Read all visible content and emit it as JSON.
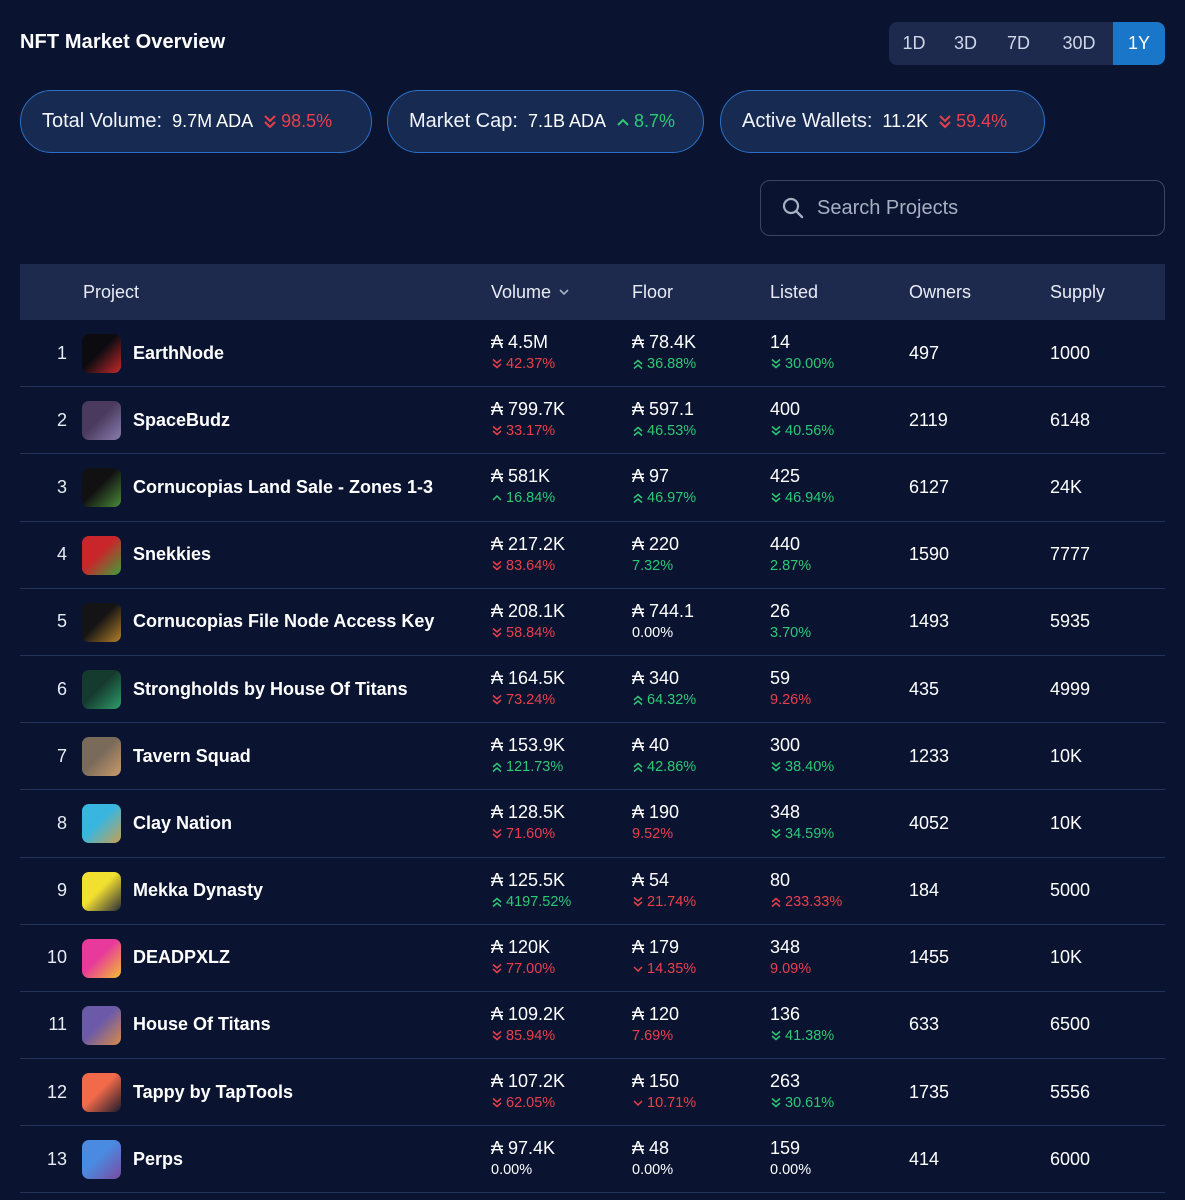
{
  "header": {
    "title": "NFT Market Overview"
  },
  "timeframes": [
    {
      "label": "1D",
      "active": false
    },
    {
      "label": "3D",
      "active": false
    },
    {
      "label": "7D",
      "active": false
    },
    {
      "label": "30D",
      "active": false
    },
    {
      "label": "1Y",
      "active": true
    }
  ],
  "stats": [
    {
      "label": "Total Volume:",
      "value": "9.7M ADA",
      "change": "98.5%",
      "direction": "down"
    },
    {
      "label": "Market Cap:",
      "value": "7.1B ADA",
      "change": "8.7%",
      "direction": "up"
    },
    {
      "label": "Active Wallets:",
      "value": "11.2K",
      "change": "59.4%",
      "direction": "down"
    }
  ],
  "search": {
    "placeholder": "Search Projects"
  },
  "table": {
    "columns": {
      "project": "Project",
      "volume": "Volume",
      "floor": "Floor",
      "listed": "Listed",
      "owners": "Owners",
      "supply": "Supply"
    },
    "rows": [
      {
        "rank": "1",
        "name": "EarthNode",
        "volume": "₳ 4.5M",
        "volume_change": "42.37%",
        "volume_dir": "down2",
        "floor": "₳ 78.4K",
        "floor_change": "36.88%",
        "floor_dir": "up2",
        "listed": "14",
        "listed_change": "30.00%",
        "listed_dir": "listdown",
        "owners": "497",
        "supply": "1000",
        "avatar_colors": [
          "#0b0b10",
          "#c72a2a"
        ]
      },
      {
        "rank": "2",
        "name": "SpaceBudz",
        "volume": "₳ 799.7K",
        "volume_change": "33.17%",
        "volume_dir": "down2",
        "floor": "₳ 597.1",
        "floor_change": "46.53%",
        "floor_dir": "up2",
        "listed": "400",
        "listed_change": "40.56%",
        "listed_dir": "listdown",
        "owners": "2119",
        "supply": "6148",
        "avatar_colors": [
          "#4a3a5e",
          "#8a7eb0"
        ]
      },
      {
        "rank": "3",
        "name": "Cornucopias Land Sale - Zones 1-3",
        "volume": "₳ 581K",
        "volume_change": "16.84%",
        "volume_dir": "up1",
        "floor": "₳ 97",
        "floor_change": "46.97%",
        "floor_dir": "up2",
        "listed": "425",
        "listed_change": "46.94%",
        "listed_dir": "listdown",
        "owners": "6127",
        "supply": "24K",
        "avatar_colors": [
          "#111111",
          "#4a8a3a"
        ]
      },
      {
        "rank": "4",
        "name": "Snekkies",
        "volume": "₳ 217.2K",
        "volume_change": "83.64%",
        "volume_dir": "down2",
        "floor": "₳ 220",
        "floor_change": "7.32%",
        "floor_dir": "upplain",
        "listed": "440",
        "listed_change": "2.87%",
        "listed_dir": "listplain",
        "owners": "1590",
        "supply": "7777",
        "avatar_colors": [
          "#c8262a",
          "#3fa03a"
        ]
      },
      {
        "rank": "5",
        "name": "Cornucopias File Node Access Key",
        "volume": "₳ 208.1K",
        "volume_change": "58.84%",
        "volume_dir": "down2",
        "floor": "₳ 744.1",
        "floor_change": "0.00%",
        "floor_dir": "neutral",
        "listed": "26",
        "listed_change": "3.70%",
        "listed_dir": "listplain",
        "owners": "1493",
        "supply": "5935",
        "avatar_colors": [
          "#141414",
          "#b5802a"
        ]
      },
      {
        "rank": "6",
        "name": "Strongholds by House Of Titans",
        "volume": "₳ 164.5K",
        "volume_change": "73.24%",
        "volume_dir": "down2",
        "floor": "₳ 340",
        "floor_change": "64.32%",
        "floor_dir": "up2",
        "listed": "59",
        "listed_change": "9.26%",
        "listed_dir": "downplain",
        "owners": "435",
        "supply": "4999",
        "avatar_colors": [
          "#153a2e",
          "#2e9e6a"
        ]
      },
      {
        "rank": "7",
        "name": "Tavern Squad",
        "volume": "₳ 153.9K",
        "volume_change": "121.73%",
        "volume_dir": "up2",
        "floor": "₳ 40",
        "floor_change": "42.86%",
        "floor_dir": "up2",
        "listed": "300",
        "listed_change": "38.40%",
        "listed_dir": "listdown",
        "owners": "1233",
        "supply": "10K",
        "avatar_colors": [
          "#7a6a5a",
          "#c89a6a"
        ]
      },
      {
        "rank": "8",
        "name": "Clay Nation",
        "volume": "₳ 128.5K",
        "volume_change": "71.60%",
        "volume_dir": "down2",
        "floor": "₳ 190",
        "floor_change": "9.52%",
        "floor_dir": "downplain",
        "listed": "348",
        "listed_change": "34.59%",
        "listed_dir": "listdown",
        "owners": "4052",
        "supply": "10K",
        "avatar_colors": [
          "#38b6e0",
          "#c8a050"
        ]
      },
      {
        "rank": "9",
        "name": "Mekka Dynasty",
        "volume": "₳ 125.5K",
        "volume_change": "4197.52%",
        "volume_dir": "up2",
        "floor": "₳ 54",
        "floor_change": "21.74%",
        "floor_dir": "down2",
        "listed": "80",
        "listed_change": "233.33%",
        "listed_dir": "listup",
        "owners": "184",
        "supply": "5000",
        "avatar_colors": [
          "#f2e030",
          "#2a2a3a"
        ]
      },
      {
        "rank": "10",
        "name": "DEADPXLZ",
        "volume": "₳ 120K",
        "volume_change": "77.00%",
        "volume_dir": "down2",
        "floor": "₳ 179",
        "floor_change": "14.35%",
        "floor_dir": "down1",
        "listed": "348",
        "listed_change": "9.09%",
        "listed_dir": "downplain",
        "owners": "1455",
        "supply": "10K",
        "avatar_colors": [
          "#e83a9a",
          "#f2c030"
        ]
      },
      {
        "rank": "11",
        "name": "House Of Titans",
        "volume": "₳ 109.2K",
        "volume_change": "85.94%",
        "volume_dir": "down2",
        "floor": "₳ 120",
        "floor_change": "7.69%",
        "floor_dir": "downplain",
        "listed": "136",
        "listed_change": "41.38%",
        "listed_dir": "listdown",
        "owners": "633",
        "supply": "6500",
        "avatar_colors": [
          "#6a5aa8",
          "#d88a4a"
        ]
      },
      {
        "rank": "12",
        "name": "Tappy by TapTools",
        "volume": "₳ 107.2K",
        "volume_change": "62.05%",
        "volume_dir": "down2",
        "floor": "₳ 150",
        "floor_change": "10.71%",
        "floor_dir": "down1",
        "listed": "263",
        "listed_change": "30.61%",
        "listed_dir": "listdown",
        "owners": "1735",
        "supply": "5556",
        "avatar_colors": [
          "#f26a4a",
          "#1a1a2a"
        ]
      },
      {
        "rank": "13",
        "name": "Perps",
        "volume": "₳ 97.4K",
        "volume_change": "0.00%",
        "volume_dir": "neutral",
        "floor": "₳ 48",
        "floor_change": "0.00%",
        "floor_dir": "neutral",
        "listed": "159",
        "listed_change": "0.00%",
        "listed_dir": "neutral",
        "owners": "414",
        "supply": "6000",
        "avatar_colors": [
          "#4a8ae0",
          "#7a4aa0"
        ]
      }
    ]
  },
  "colors": {
    "background": "#0a1431",
    "accent": "#1a76c8",
    "up": "#2ec876",
    "down": "#e8404b"
  },
  "icons": {
    "search": "search-icon",
    "sort": "chevron-down-icon",
    "up": "double-chevron-up-icon",
    "down": "double-chevron-down-icon"
  }
}
